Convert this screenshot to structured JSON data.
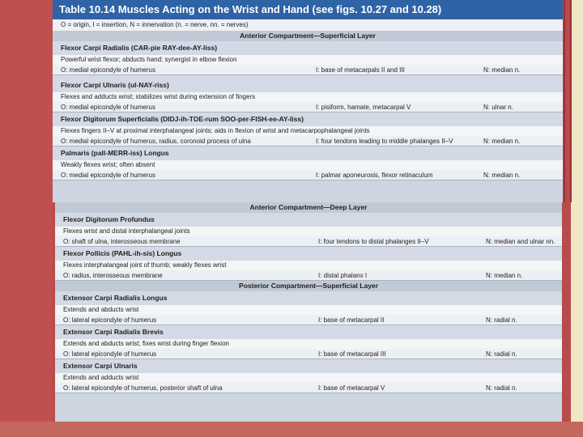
{
  "title": "Table 10.14 Muscles Acting on the Wrist and Hand (see figs. 10.27 and 10.28)",
  "legend": "O = origin, I = insertion, N = innervation (n. = nerve, nn. = nerves)",
  "sections": [
    {
      "heading": "Anterior Compartment—Superficial Layer",
      "muscles": [
        {
          "name": "Flexor Carpi Radialis (CAR-pie RAY-dee-AY-liss)",
          "action": "Powerful wrist flexor; abducts hand; synergist in elbow flexion",
          "origin": "O: medial epicondyle of humerus",
          "insertion": "I: base of metacarpals II and III",
          "innervation": "N: median n."
        },
        {
          "name": "Flexor Carpi Ulnaris (ul-NAY-riss)",
          "action": "Flexes and adducts wrist; stabilizes wrist during extension of fingers",
          "origin": "O: medial epicondyle of humerus",
          "insertion": "I: pisiform, hamate, metacarpal V",
          "innervation": "N: ulnar n."
        },
        {
          "name": "Flexor Digitorum Superficialis (DIDJ-ih-TOE-rum SOO-per-FISH-ee-AY-liss)",
          "action": "Flexes fingers II–V at proximal interphalangeal joints; aids in flexion of wrist and metacarpophalangeal joints",
          "origin": "O: medial epicondyle of humerus, radius, coronoid process of ulna",
          "insertion": "I: four tendons leading to middle phalanges II–V",
          "innervation": "N: median n."
        },
        {
          "name": "Palmaris (pall-MERR-iss) Longus",
          "action": "Weakly flexes wrist; often absent",
          "origin": "O: medial epicondyle of humerus",
          "insertion": "I: palmar aponeurosis, flexor retinaculum",
          "innervation": "N: median n."
        }
      ]
    },
    {
      "heading": "Anterior Compartment—Deep Layer",
      "muscles": [
        {
          "name": "Flexor Digitorum Profundus",
          "action": "Flexes wrist and distal interphalangeal joints",
          "origin": "O: shaft of ulna, interosseous membrane",
          "insertion": "I: four tendons to distal phalanges II–V",
          "innervation": "N: median and ulnar nn."
        },
        {
          "name": "Flexor Pollicis (PAHL-ih-sis) Longus",
          "action": "Flexes interphalangeal joint of thumb; weakly flexes wrist",
          "origin": "O: radius, interosseous membrane",
          "insertion": "I: distal phalanx I",
          "innervation": "N: median n."
        }
      ]
    },
    {
      "heading": "Posterior Compartment—Superficial Layer",
      "muscles": [
        {
          "name": "Extensor Carpi Radialis Longus",
          "action": "Extends and abducts wrist",
          "origin": "O: lateral epicondyle of humerus",
          "insertion": "I: base of metacarpal II",
          "innervation": "N: radial n."
        },
        {
          "name": "Extensor Carpi Radialis Brevis",
          "action": "Extends and abducts wrist; fixes wrist during finger flexion",
          "origin": "O: lateral epicondyle of humerus",
          "insertion": "I: base of metacarpal III",
          "innervation": "N: radial n."
        },
        {
          "name": "Extensor Carpi Ulnaris",
          "action": "Extends and adducts wrist",
          "origin": "O: lateral epicondyle of humerus, posterior shaft of ulna",
          "insertion": "I: base of metacarpal V",
          "innervation": "N: radial n."
        }
      ]
    }
  ]
}
